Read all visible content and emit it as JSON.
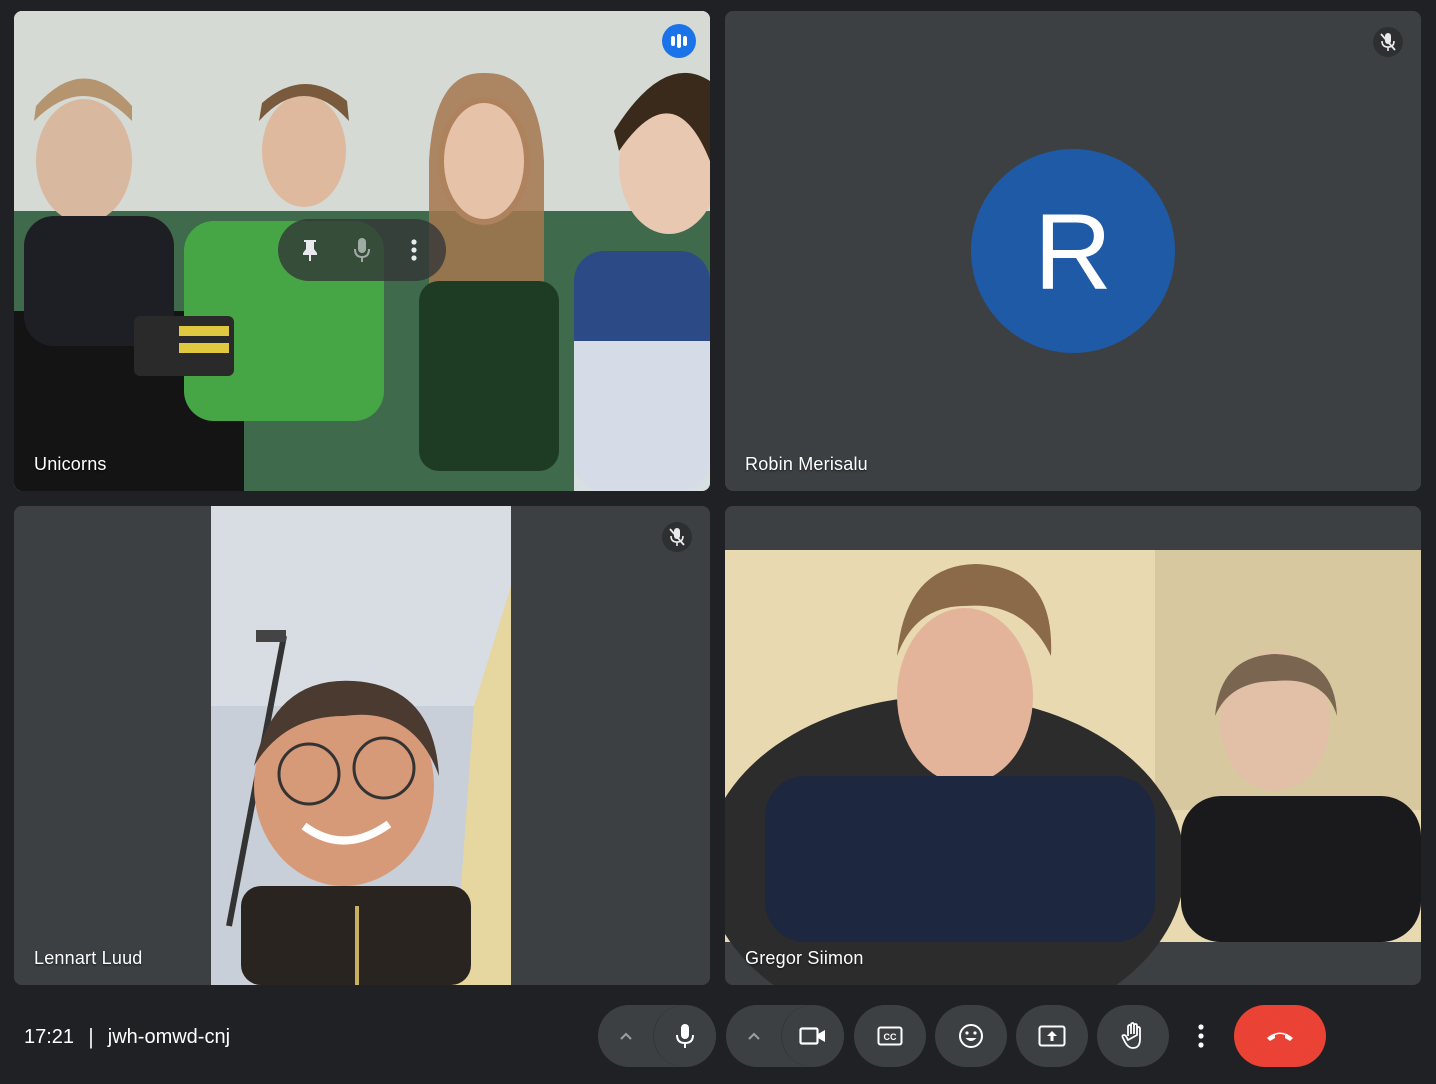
{
  "tiles": [
    {
      "name": "Unicorns",
      "state": "speaking",
      "hover_controls": [
        "pin-icon",
        "mic-icon",
        "more-vert-icon"
      ]
    },
    {
      "name": "Robin Merisalu",
      "state": "muted",
      "avatar_initial": "R",
      "avatar_color": "#1f5aa6"
    },
    {
      "name": "Lennart Luud",
      "state": "muted"
    },
    {
      "name": "Gregor Siimon",
      "state": "normal"
    }
  ],
  "meeting": {
    "time": "17:21",
    "separator": "|",
    "code": "jwh-omwd-cnj"
  },
  "controls": [
    "audio-options-caret",
    "microphone-button",
    "video-options-caret",
    "camera-button",
    "captions-button",
    "reactions-button",
    "present-button",
    "raise-hand-button",
    "more-options-button",
    "leave-call-button"
  ],
  "colors": {
    "background": "#202124",
    "tile": "#3c4043",
    "active_outline": "#8ab4f8",
    "speaking_badge": "#1a73e8",
    "end_call": "#ea4335"
  }
}
